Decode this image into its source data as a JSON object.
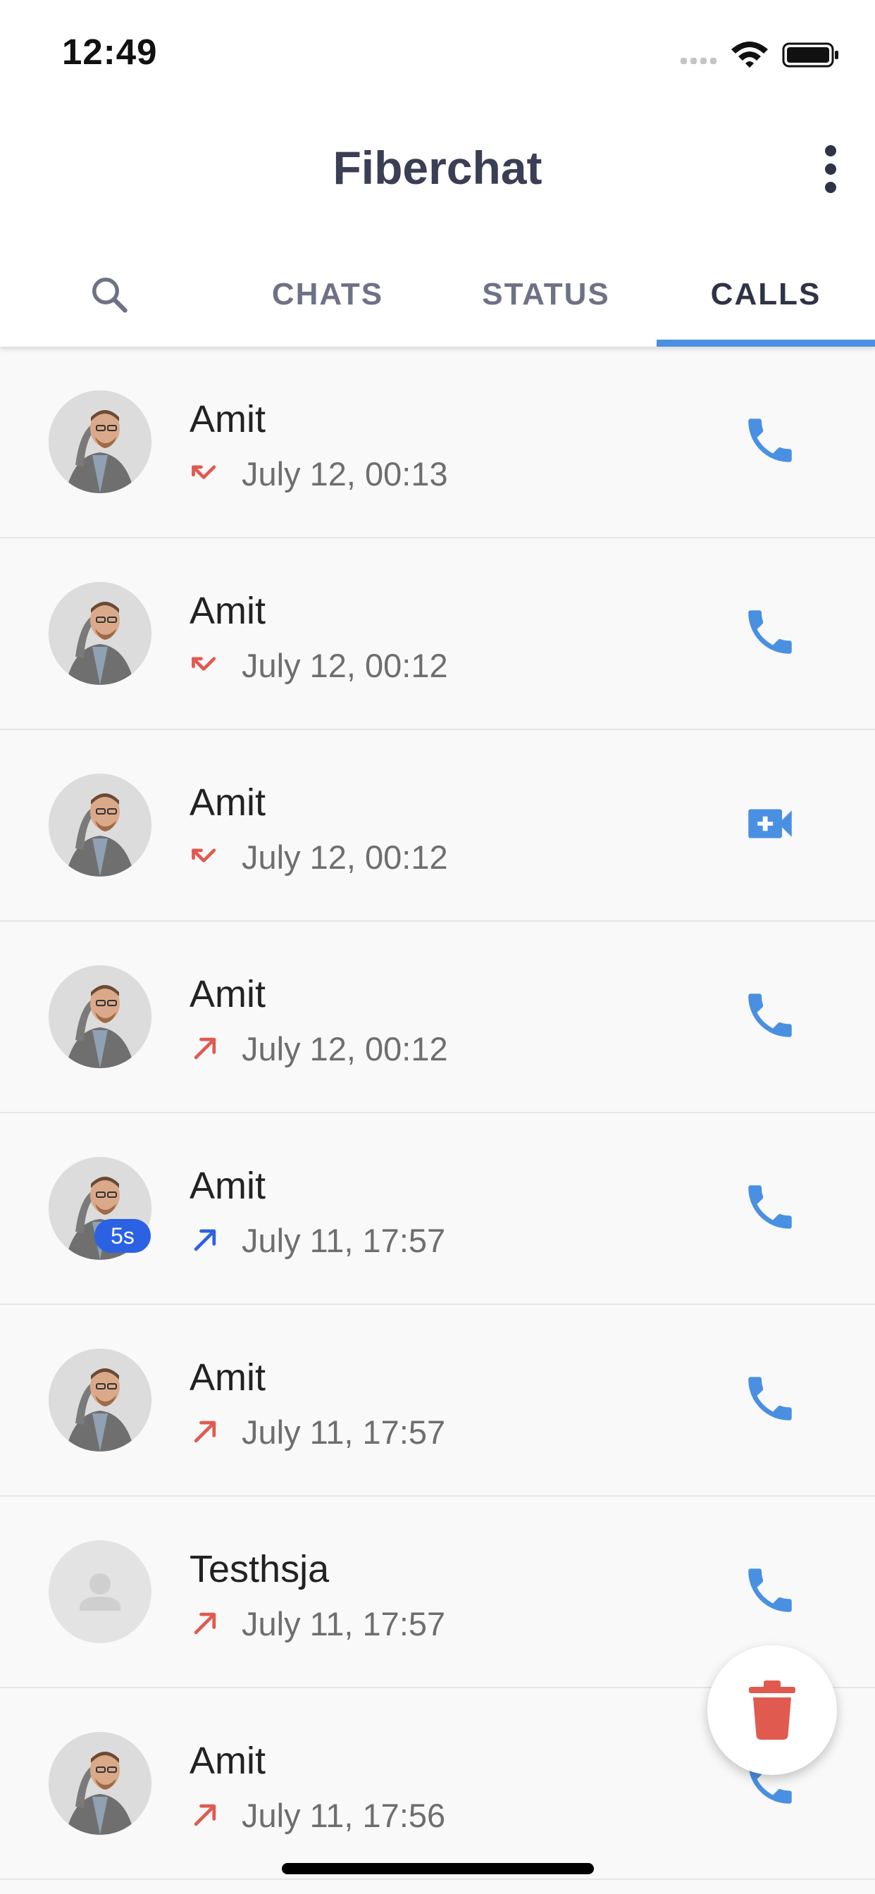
{
  "status_bar": {
    "time": "12:49",
    "icons": [
      "signal-icon",
      "wifi-icon",
      "battery-icon"
    ]
  },
  "header": {
    "title": "Fiberchat",
    "menu_icon": "more-vert-icon"
  },
  "tabs": [
    {
      "label": "",
      "icon": "search-icon"
    },
    {
      "label": "CHATS"
    },
    {
      "label": "STATUS"
    },
    {
      "label": "CALLS",
      "active": true
    }
  ],
  "calls": [
    {
      "name": "Amit",
      "time": "July 12, 00:13",
      "direction": "missed",
      "type": "voice"
    },
    {
      "name": "Amit",
      "time": "July 12, 00:12",
      "direction": "missed",
      "type": "voice"
    },
    {
      "name": "Amit",
      "time": "July 12, 00:12",
      "direction": "missed",
      "type": "video"
    },
    {
      "name": "Amit",
      "time": "July 12, 00:12",
      "direction": "outgoing-unanswered",
      "type": "voice"
    },
    {
      "name": "Amit",
      "time": "July 11, 17:57",
      "direction": "outgoing-answered",
      "type": "voice",
      "duration": "5s"
    },
    {
      "name": "Amit",
      "time": "July 11, 17:57",
      "direction": "outgoing-unanswered",
      "type": "voice"
    },
    {
      "name": "Testhsja",
      "time": "July 11, 17:57",
      "direction": "outgoing-unanswered",
      "type": "voice",
      "avatar": "placeholder"
    },
    {
      "name": "Amit",
      "time": "July 11, 17:56",
      "direction": "outgoing-unanswered",
      "type": "voice"
    }
  ],
  "fab": {
    "icon": "delete-icon"
  },
  "colors": {
    "accent": "#4a90e2",
    "missed": "#e05a4f",
    "answered": "#2b62e3",
    "title": "#3a3f55",
    "delete": "#e05a4f"
  }
}
